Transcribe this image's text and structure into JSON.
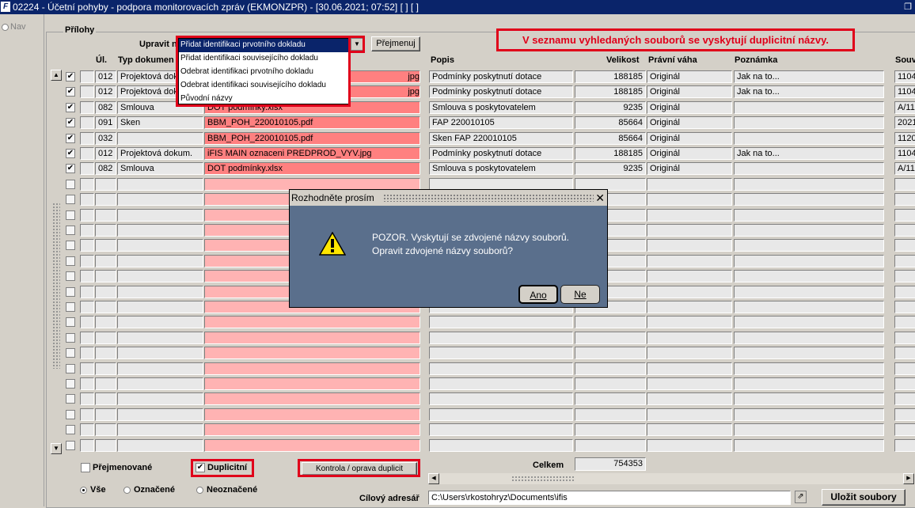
{
  "window": {
    "title": "02224 - Účetní pohyby - podpora monitorovacích zpráv (EKMONZPR) - [30.06.2021; 07:52]  [ ]  [ ]",
    "logo": "F"
  },
  "nav_label": "Nav",
  "section_label": "Přílohy",
  "toolbar": {
    "upravit_label": "Upravit n",
    "rename_button": "Přejmenuj"
  },
  "warning_banner": "V seznamu vyhledaných souborů se vyskytují duplicitní názvy.",
  "dropdown": {
    "options": [
      "Přidat identifikaci prvotního dokladu",
      "Přidat identifikaci souvisejícího dokladu",
      "Odebrat identifikaci prvotního dokladu",
      "Odebrat identifikaci souvisejícího dokladu",
      "Původní názvy"
    ],
    "selected_index": 0
  },
  "columns": {
    "ul": "Úl.",
    "typ": "Typ dokumen",
    "popis": "Popis",
    "velikost": "Velikost",
    "pravni": "Právní váha",
    "poznamka": "Poznámka",
    "souv": "Souv"
  },
  "rows": [
    {
      "checked": true,
      "ul": "012",
      "typ": "Projektová doku",
      "name": "jpg",
      "popis": "Podmínky poskytnutí dotace",
      "velikost": "188185",
      "pravni": "Originál",
      "poznamka": "Jak na to...",
      "souv": "1104"
    },
    {
      "checked": true,
      "ul": "012",
      "typ": "Projektová doku",
      "name": "jpg",
      "popis": "Podmínky poskytnutí dotace",
      "velikost": "188185",
      "pravni": "Originál",
      "poznamka": "Jak na to...",
      "souv": "1104"
    },
    {
      "checked": true,
      "ul": "082",
      "typ": "Smlouva",
      "name": "DOT podmínky.xlsx",
      "popis": "Smlouva s poskytovatelem",
      "velikost": "9235",
      "pravni": "Originál",
      "poznamka": "",
      "souv": "A/11"
    },
    {
      "checked": true,
      "ul": "091",
      "typ": "Sken",
      "name": "BBM_POH_220010105.pdf",
      "popis": "FAP 220010105",
      "velikost": "85664",
      "pravni": "Originál",
      "poznamka": "",
      "souv": "2021"
    },
    {
      "checked": true,
      "ul": "032",
      "typ": "",
      "name": "BBM_POH_220010105.pdf",
      "popis": "Sken FAP 220010105",
      "velikost": "85664",
      "pravni": "Originál",
      "poznamka": "",
      "souv": "1120"
    },
    {
      "checked": true,
      "ul": "012",
      "typ": "Projektová dokum.",
      "name": "iFIS MAIN oznaceni PREDPROD_VYV.jpg",
      "popis": "Podmínky poskytnutí dotace",
      "velikost": "188185",
      "pravni": "Originál",
      "poznamka": "Jak na to...",
      "souv": "1104"
    },
    {
      "checked": true,
      "ul": "082",
      "typ": "Smlouva",
      "name": "DOT podmínky.xlsx",
      "popis": "Smlouva s poskytovatelem",
      "velikost": "9235",
      "pravni": "Originál",
      "poznamka": "",
      "souv": "A/11"
    }
  ],
  "dialog": {
    "title": "Rozhodněte prosím",
    "message": "POZOR. Vyskytují se zdvojené názvy souborů. Opravit zdvojené názvy souborů?",
    "yes": "Ano",
    "no": "Ne"
  },
  "bottom": {
    "renamed_label": "Přejmenované",
    "duplicates_label": "Duplicitní",
    "duplicates_checked": true,
    "check_button": "Kontrola / oprava duplicit",
    "total_label": "Celkem",
    "total_value": "754353",
    "radio_all": "Vše",
    "radio_marked": "Označené",
    "radio_unmarked": "Neoznačené",
    "target_label": "Cílový adresář",
    "target_value": "C:\\Users\\rkostohryz\\Documents\\ifis",
    "save_button": "Uložit soubory"
  },
  "colors": {
    "title_bar": "#0a246a",
    "highlight_red": "#e0001a",
    "duplicate_pink": "#ff8080",
    "empty_pink": "#ffb3b3",
    "dialog_bg": "#5a6f8c"
  }
}
